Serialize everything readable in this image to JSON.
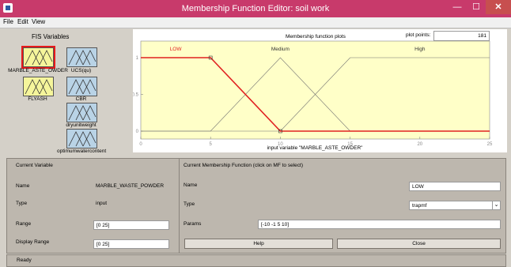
{
  "window": {
    "title": "Membership Function Editor: soil work",
    "minimize": "—",
    "maximize": "☐",
    "close": "✕"
  },
  "menu": [
    "File",
    "Edit",
    "View"
  ],
  "fis": {
    "title": "FIS Variables",
    "variables": [
      {
        "label": "MARBLE_ASTE_OWDER",
        "kind": "input",
        "selected": true
      },
      {
        "label": "UCS(qu)",
        "kind": "output"
      },
      {
        "label": "FLYASH",
        "kind": "input"
      },
      {
        "label": "CBR",
        "kind": "output"
      },
      {
        "label": "dryunitweight",
        "kind": "output"
      },
      {
        "label": "optimumwatercontent",
        "kind": "output"
      }
    ]
  },
  "plot": {
    "title": "Membership function plots",
    "points_label": "plot points:",
    "points_value": "181",
    "xlabel": "input variable \"MARBLE_ASTE_OWDER\"",
    "mf_labels": [
      "LOW",
      "Medium",
      "High"
    ]
  },
  "chart_data": {
    "type": "line",
    "xlim": [
      0,
      25
    ],
    "ylim": [
      0,
      1
    ],
    "x_ticks": [
      "0",
      "5",
      "10",
      "15",
      "20",
      "25"
    ],
    "y_ticks": [
      "0",
      "0.5",
      "1"
    ],
    "series": [
      {
        "name": "LOW",
        "points": [
          [
            0,
            1
          ],
          [
            5,
            1
          ],
          [
            10,
            0
          ],
          [
            25,
            0
          ]
        ],
        "selected": true
      },
      {
        "name": "Medium",
        "points": [
          [
            0,
            0
          ],
          [
            5,
            0
          ],
          [
            10,
            1
          ],
          [
            15,
            0
          ],
          [
            25,
            0
          ]
        ]
      },
      {
        "name": "High",
        "points": [
          [
            0,
            0
          ],
          [
            10,
            0
          ],
          [
            15,
            1
          ],
          [
            25,
            1
          ]
        ]
      }
    ],
    "colors": {
      "selected": "#e02020",
      "normal": "#707070",
      "background": "#ffffc8"
    }
  },
  "current_variable": {
    "header": "Current Variable",
    "name_label": "Name",
    "name_value": "MARBLE_WASTE_POWDER",
    "type_label": "Type",
    "type_value": "input",
    "range_label": "Range",
    "range_value": "[0 25]",
    "display_range_label": "Display Range",
    "display_range_value": "[0 25]"
  },
  "current_mf": {
    "header": "Current Membership Function (click on MF to select)",
    "name_label": "Name",
    "name_value": "LOW",
    "type_label": "Type",
    "type_value": "trapmf",
    "params_label": "Params",
    "params_value": "[-10 -1 5 10]"
  },
  "buttons": {
    "help": "Help",
    "close": "Close"
  },
  "status": "Ready"
}
